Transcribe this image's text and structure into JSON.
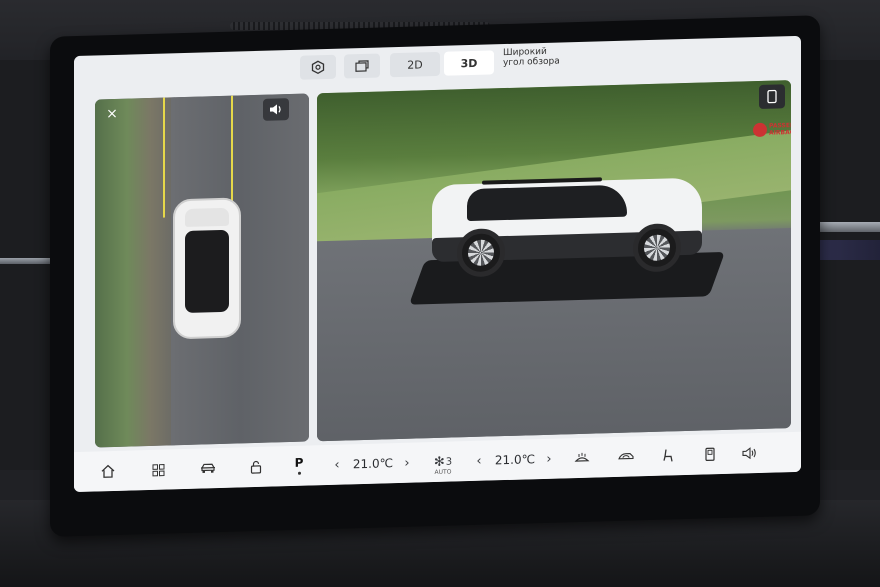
{
  "topbar": {
    "settings_icon": "hexagon-settings-icon",
    "view_toggle_icon": "window-toggle-icon",
    "mode_2d": "2D",
    "mode_3d": "3D",
    "wide_label_line1": "Широкий",
    "wide_label_line2": "угол обзора"
  },
  "topview": {
    "close_icon": "×",
    "sound_icon": "🔈"
  },
  "view3d": {
    "airbag_line1": "PASSENGER",
    "airbag_line2": "AIRBAG ON",
    "phone_icon": "▯"
  },
  "dock": {
    "home_icon": "⌂",
    "apps_icon": "▦",
    "car_icon": "🚗",
    "lock_icon": "🔓",
    "parking_label": "P",
    "left_temp_dec": "‹",
    "left_temp": "21.0℃",
    "left_temp_inc": "›",
    "fan_icon": "✻",
    "fan_level": "3",
    "fan_mode": "AUTO",
    "right_temp_dec": "‹",
    "right_temp": "21.0℃",
    "right_temp_inc": "›",
    "defrost_icon": "♨",
    "recirc_icon": "⇌",
    "seat_icon": "♿",
    "door_icon": "▯",
    "volume_icon": "🔊"
  },
  "colors": {
    "screen_bg": "#eceef1",
    "accent_active_tab": "#ffffff",
    "guide_line": "#e6d84a",
    "airbag_red": "#cc3333"
  }
}
